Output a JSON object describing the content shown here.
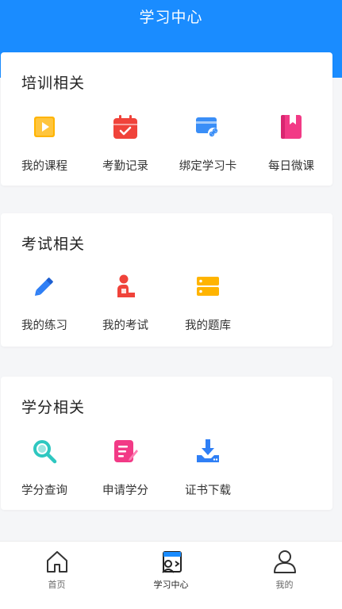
{
  "header": {
    "title": "学习中心"
  },
  "sections": [
    {
      "title": "培训相关",
      "items": [
        {
          "label": "我的课程",
          "icon": "video-play-icon",
          "color": "#ffb400"
        },
        {
          "label": "考勤记录",
          "icon": "calendar-check-icon",
          "color": "#f0433a"
        },
        {
          "label": "绑定学习卡",
          "icon": "card-link-icon",
          "color": "#3a8ef7"
        },
        {
          "label": "每日微课",
          "icon": "bookmark-book-icon",
          "color": "#f23a86"
        }
      ]
    },
    {
      "title": "考试相关",
      "items": [
        {
          "label": "我的练习",
          "icon": "pencil-icon",
          "color": "#2f7ff5"
        },
        {
          "label": "我的考试",
          "icon": "exam-person-icon",
          "color": "#f0433a"
        },
        {
          "label": "我的题库",
          "icon": "question-bank-icon",
          "color": "#ffb400"
        }
      ]
    },
    {
      "title": "学分相关",
      "items": [
        {
          "label": "学分查询",
          "icon": "search-icon",
          "color": "#2ec7c0"
        },
        {
          "label": "申请学分",
          "icon": "edit-form-icon",
          "color": "#f23a86"
        },
        {
          "label": "证书下载",
          "icon": "download-icon",
          "color": "#2f7ff5"
        }
      ]
    }
  ],
  "tabbar": {
    "items": [
      {
        "label": "首页",
        "icon": "home-icon"
      },
      {
        "label": "学习中心",
        "icon": "study-center-icon",
        "active": true
      },
      {
        "label": "我的",
        "icon": "user-icon"
      }
    ]
  }
}
